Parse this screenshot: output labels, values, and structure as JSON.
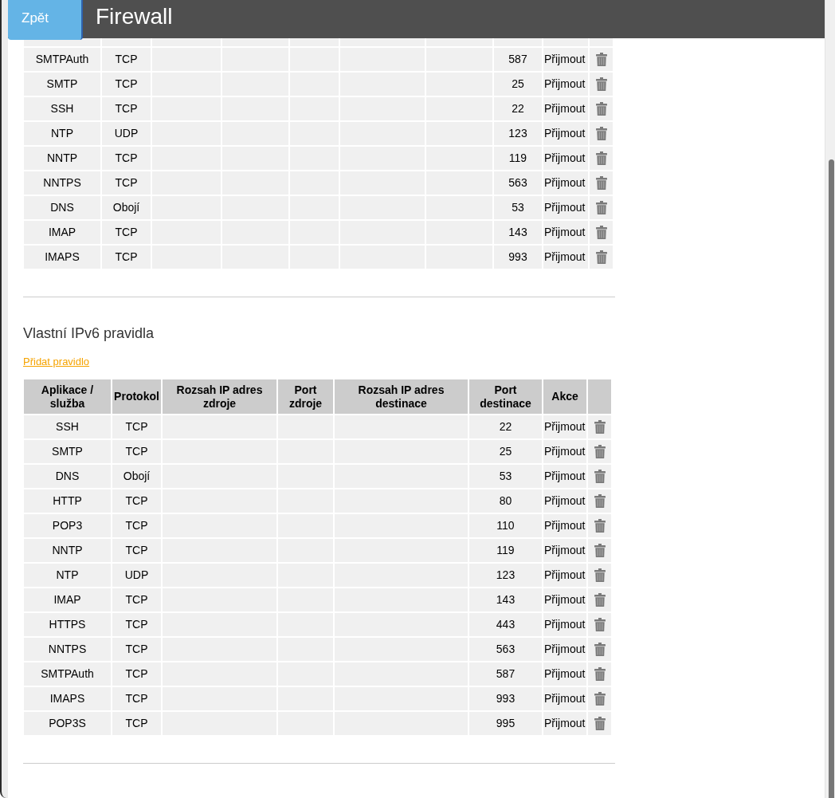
{
  "header": {
    "back_button": "Zpět",
    "title": "Firewall"
  },
  "upper_table": {
    "rows": [
      {
        "column_1": "SMTPAuth",
        "column_2": "TCP",
        "column_8": "587",
        "column_9": "Přijmout"
      },
      {
        "column_1": "SMTP",
        "column_2": "TCP",
        "column_8": "25",
        "column_9": "Přijmout"
      },
      {
        "column_1": "SSH",
        "column_2": "TCP",
        "column_8": "22",
        "column_9": "Přijmout"
      },
      {
        "column_1": "NTP",
        "column_2": "UDP",
        "column_8": "123",
        "column_9": "Přijmout"
      },
      {
        "column_1": "NNTP",
        "column_2": "TCP",
        "column_8": "119",
        "column_9": "Přijmout"
      },
      {
        "column_1": "NNTPS",
        "column_2": "TCP",
        "column_8": "563",
        "column_9": "Přijmout"
      },
      {
        "column_1": "DNS",
        "column_2": "Obojí",
        "column_8": "53",
        "column_9": "Přijmout"
      },
      {
        "column_1": "IMAP",
        "column_2": "TCP",
        "column_8": "143",
        "column_9": "Přijmout"
      },
      {
        "column_1": "IMAPS",
        "column_2": "TCP",
        "column_8": "993",
        "column_9": "Přijmout"
      }
    ]
  },
  "ipv6_rules": {
    "title": "Vlastní IPv6 pravidla",
    "add_link": "Přidat pravidlo",
    "columns": [
      "Aplikace / služba",
      "Protokol",
      "Rozsah IP adres zdroje",
      "Port zdroje",
      "Rozsah IP adres destinace",
      "Port destinace",
      "Akce"
    ],
    "rows": [
      {
        "application_service": "SSH",
        "protocol": "TCP",
        "destination_port": "22",
        "action": "Přijmout"
      },
      {
        "application_service": "SMTP",
        "protocol": "TCP",
        "destination_port": "25",
        "action": "Přijmout"
      },
      {
        "application_service": "DNS",
        "protocol": "Obojí",
        "destination_port": "53",
        "action": "Přijmout"
      },
      {
        "application_service": "HTTP",
        "protocol": "TCP",
        "destination_port": "80",
        "action": "Přijmout"
      },
      {
        "application_service": "POP3",
        "protocol": "TCP",
        "destination_port": "110",
        "action": "Přijmout"
      },
      {
        "application_service": "NNTP",
        "protocol": "TCP",
        "destination_port": "119",
        "action": "Přijmout"
      },
      {
        "application_service": "NTP",
        "protocol": "UDP",
        "destination_port": "123",
        "action": "Přijmout"
      },
      {
        "application_service": "IMAP",
        "protocol": "TCP",
        "destination_port": "143",
        "action": "Přijmout"
      },
      {
        "application_service": "HTTPS",
        "protocol": "TCP",
        "destination_port": "443",
        "action": "Přijmout"
      },
      {
        "application_service": "NNTPS",
        "protocol": "TCP",
        "destination_port": "563",
        "action": "Přijmout"
      },
      {
        "application_service": "SMTPAuth",
        "protocol": "TCP",
        "destination_port": "587",
        "action": "Přijmout"
      },
      {
        "application_service": "IMAPS",
        "protocol": "TCP",
        "destination_port": "993",
        "action": "Přijmout"
      },
      {
        "application_service": "POP3S",
        "protocol": "TCP",
        "destination_port": "995",
        "action": "Přijmout"
      }
    ]
  }
}
